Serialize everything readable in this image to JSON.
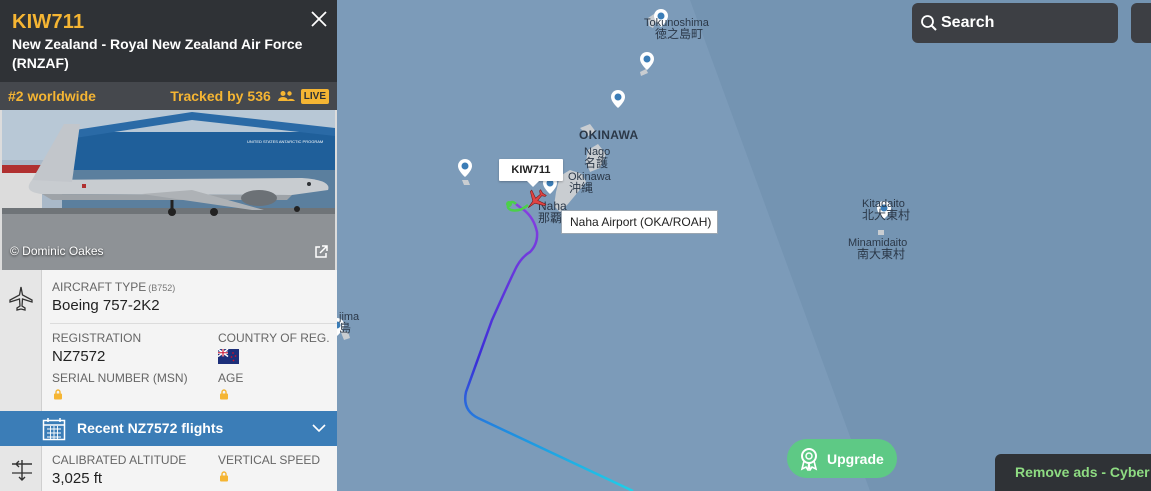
{
  "flight": {
    "callsign": "KIW711",
    "airline": "New Zealand - Royal New Zealand Air Force (RNZAF)",
    "rank": "#2 worldwide",
    "tracked_label": "Tracked by",
    "tracked_count": "536",
    "live_badge": "LIVE"
  },
  "photo": {
    "credit": "© Dominic Oakes",
    "hangar_text": "UNITED STATES ANTARCTIC PROGRAM"
  },
  "aircraft": {
    "type_label": "AIRCRAFT TYPE",
    "type_code": "(B752)",
    "type_value": "Boeing 757-2K2",
    "registration_label": "REGISTRATION",
    "registration_value": "NZ7572",
    "country_label": "COUNTRY OF REG.",
    "serial_label": "SERIAL NUMBER (MSN)",
    "age_label": "AGE"
  },
  "recent_flights": {
    "label": "Recent NZ7572 flights"
  },
  "altitude": {
    "calibrated_label": "CALIBRATED ALTITUDE",
    "calibrated_value": "3,025 ft",
    "vertical_label": "VERTICAL SPEED"
  },
  "map": {
    "callsign_tag": "KIW711",
    "airport_tag": "Naha Airport (OKA/ROAH)",
    "labels": {
      "tokunoshima": "Tokunoshima",
      "tokunoshima_jp": "徳之島町",
      "okinawa_region": "OKINAWA",
      "nago": "Nago",
      "nago_jp": "名護",
      "okinawa_city": "Okinawa",
      "okinawa_jp": "沖縄",
      "naha": "Naha",
      "naha_jp": "那覇",
      "kitadaito": "Kitadaito",
      "kitadaito_jp": "北大東村",
      "minamidaito": "Minamidaito",
      "minamidaito_jp": "南大東村",
      "kumejima": "jima",
      "kumejima_jp": "島"
    }
  },
  "search": {
    "label": "Search"
  },
  "upgrade": {
    "label": "Upgrade"
  },
  "ads": {
    "label": "Remove ads - Cyber"
  },
  "colors": {
    "ocean": "#7c9bb9",
    "panel_header": "#2f3236",
    "callsign": "#f5b533",
    "accent_blue": "#3b7db7",
    "upgrade_green": "#5ec985",
    "ads_text": "#8edb82"
  }
}
